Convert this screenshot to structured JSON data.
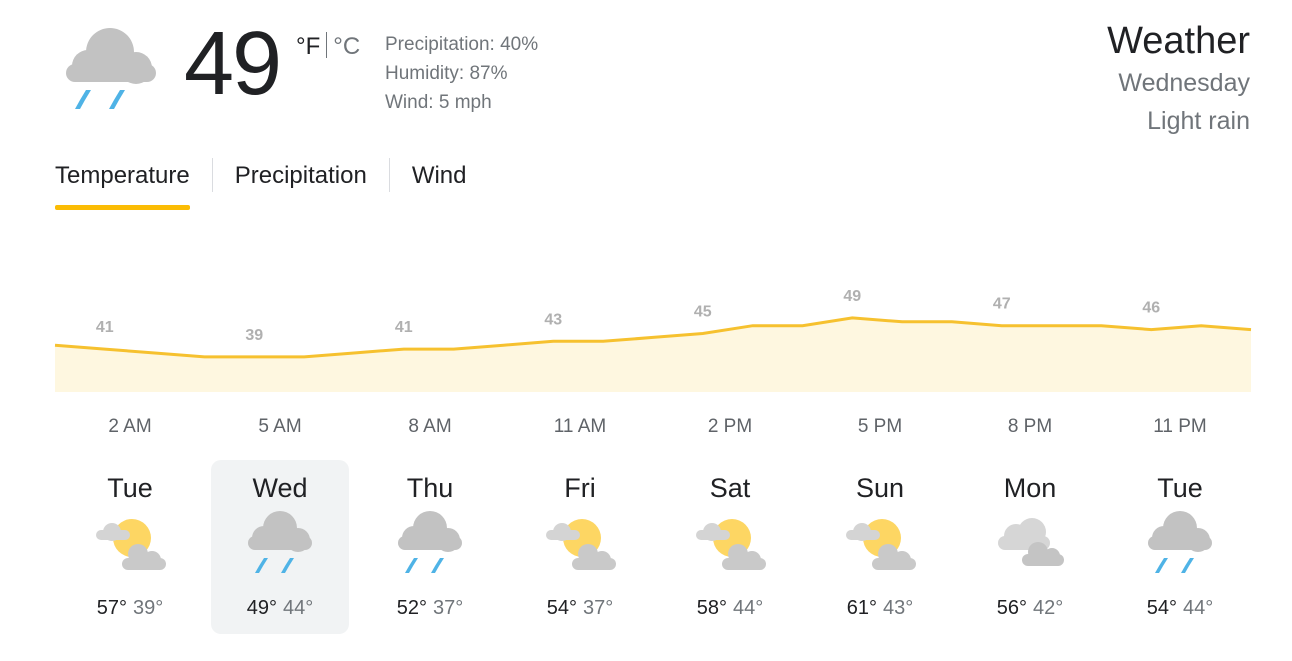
{
  "current": {
    "icon": "rain-cloud-icon",
    "temperature": "49",
    "unit_f": "°F",
    "unit_c": "°C",
    "precipitation": "Precipitation: 40%",
    "humidity": "Humidity: 87%",
    "wind": "Wind: 5 mph"
  },
  "header": {
    "title": "Weather",
    "day": "Wednesday",
    "condition": "Light rain"
  },
  "tabs": [
    {
      "label": "Temperature",
      "active": true
    },
    {
      "label": "Precipitation",
      "active": false
    },
    {
      "label": "Wind",
      "active": false
    }
  ],
  "colors": {
    "accent": "#fbbc04",
    "line": "#f6c12f",
    "fill": "#fef7e0",
    "muted_text": "#70757a",
    "selected_bg": "#f1f3f4"
  },
  "chart_data": {
    "type": "area",
    "series": [
      {
        "values": [
          42,
          41,
          40,
          39,
          39,
          39,
          40,
          41,
          41,
          42,
          43,
          43,
          44,
          45,
          47,
          47,
          49,
          48,
          48,
          47,
          47,
          47,
          46,
          47,
          46
        ]
      }
    ],
    "data_labels": [
      {
        "index": 1,
        "text": "41"
      },
      {
        "index": 4,
        "text": "39"
      },
      {
        "index": 7,
        "text": "41"
      },
      {
        "index": 10,
        "text": "43"
      },
      {
        "index": 13,
        "text": "45"
      },
      {
        "index": 16,
        "text": "49"
      },
      {
        "index": 19,
        "text": "47"
      },
      {
        "index": 22,
        "text": "46"
      }
    ],
    "x_labels": [
      "2 AM",
      "5 AM",
      "8 AM",
      "11 AM",
      "2 PM",
      "5 PM",
      "8 PM",
      "11 PM"
    ],
    "ylim": [
      30,
      55
    ],
    "grid": false
  },
  "days": [
    {
      "name": "Tue",
      "icon": "partly-cloudy-icon",
      "high": "57°",
      "low": "39°",
      "selected": false
    },
    {
      "name": "Wed",
      "icon": "rain-cloud-icon",
      "high": "49°",
      "low": "44°",
      "selected": true
    },
    {
      "name": "Thu",
      "icon": "rain-cloud-icon",
      "high": "52°",
      "low": "37°",
      "selected": false
    },
    {
      "name": "Fri",
      "icon": "partly-cloudy-icon",
      "high": "54°",
      "low": "37°",
      "selected": false
    },
    {
      "name": "Sat",
      "icon": "partly-cloudy-icon",
      "high": "58°",
      "low": "44°",
      "selected": false
    },
    {
      "name": "Sun",
      "icon": "partly-cloudy-icon",
      "high": "61°",
      "low": "43°",
      "selected": false
    },
    {
      "name": "Mon",
      "icon": "cloudy-icon",
      "high": "56°",
      "low": "42°",
      "selected": false
    },
    {
      "name": "Tue",
      "icon": "rain-cloud-icon",
      "high": "54°",
      "low": "44°",
      "selected": false
    }
  ]
}
